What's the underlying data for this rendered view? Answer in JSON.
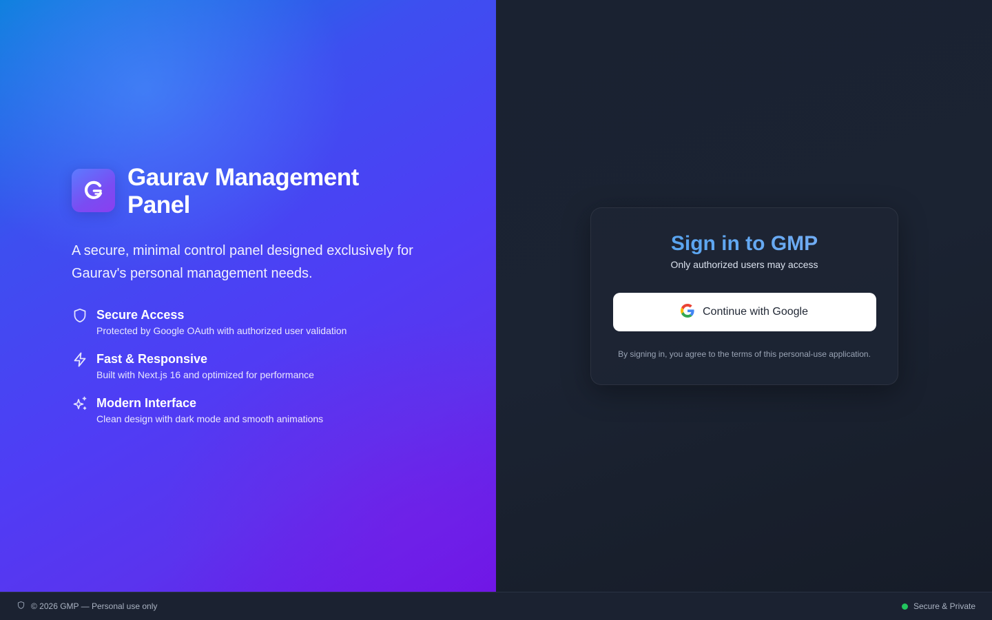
{
  "hero": {
    "logo_icon": "g-letter-logo-icon",
    "title": "Gaurav Management Panel",
    "tagline": "A secure, minimal control panel designed exclusively for Gaurav's personal management needs.",
    "features": [
      {
        "icon": "shield-icon",
        "title": "Secure Access",
        "description": "Protected by Google OAuth with authorized user validation"
      },
      {
        "icon": "lightning-icon",
        "title": "Fast & Responsive",
        "description": "Built with Next.js 16 and optimized for performance"
      },
      {
        "icon": "sparkles-icon",
        "title": "Modern Interface",
        "description": "Clean design with dark mode and smooth animations"
      }
    ]
  },
  "signin": {
    "title": "Sign in to GMP",
    "subtitle": "Only authorized users may access",
    "google_button_label": "Continue with Google",
    "terms": "By signing in, you agree to the terms of this personal-use application."
  },
  "footer": {
    "copyright": "© 2026 GMP — Personal use only",
    "status": "Secure & Private"
  },
  "colors": {
    "accent_blue": "#58a6ef",
    "status_green": "#22c55e",
    "hero_gradient_start": "#0a7fdc",
    "hero_gradient_end": "#6d12e6"
  }
}
